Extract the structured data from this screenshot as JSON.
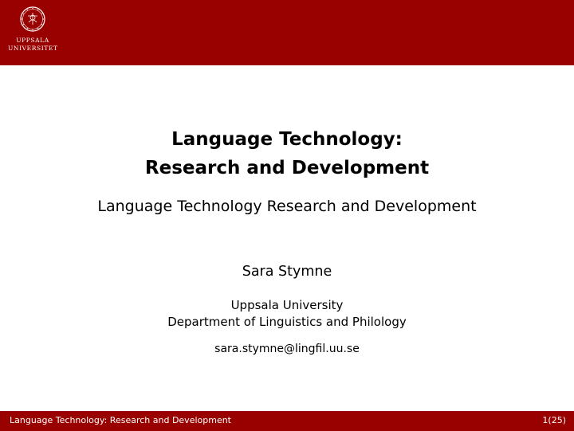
{
  "header": {
    "logo_line1": "UPPSALA",
    "logo_line2": "UNIVERSITET",
    "bar_color": "#990000"
  },
  "slide": {
    "title_line1": "Language Technology:",
    "title_line2": "Research and Development",
    "subtitle": "Language Technology Research and Development",
    "author": "Sara Stymne",
    "institution": "Uppsala University",
    "department": "Department of Linguistics and Philology",
    "email": "sara.stymne@lingfil.uu.se"
  },
  "footer": {
    "short_title": "Language Technology: Research and Development",
    "page": "1(25)"
  }
}
